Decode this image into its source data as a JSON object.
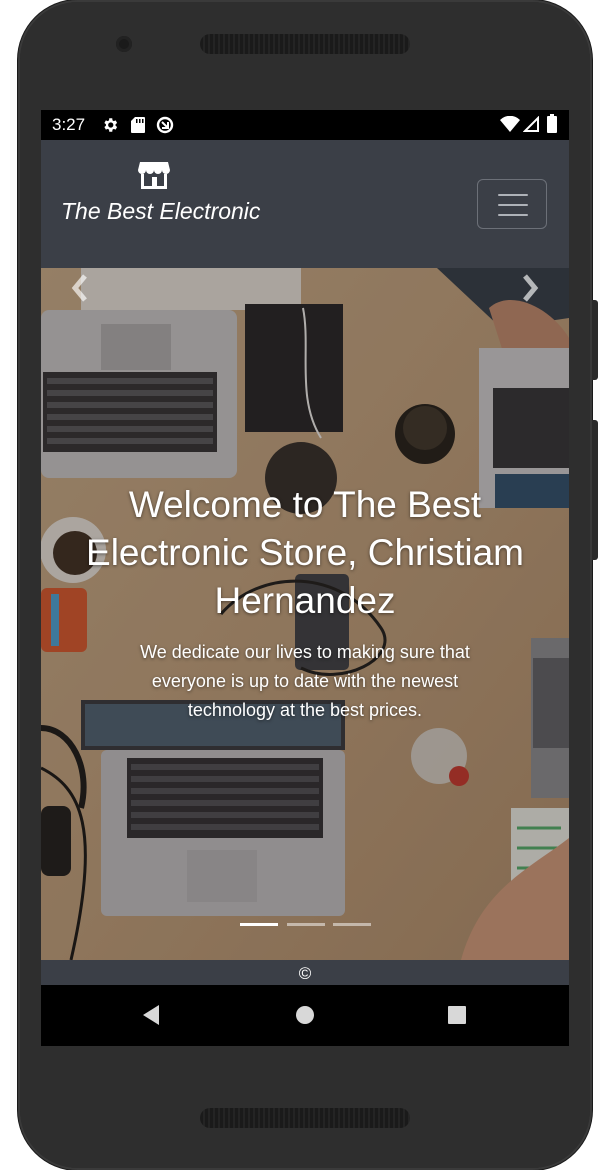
{
  "status_bar": {
    "time": "3:27",
    "icons": [
      "settings-icon",
      "sd-card-icon",
      "sync-icon",
      "wifi-icon",
      "signal-icon",
      "battery-icon"
    ]
  },
  "navbar": {
    "brand_icon": "store-icon",
    "brand_text": "The Best Electronic",
    "menu_icon": "hamburger-menu-icon"
  },
  "hero": {
    "title": "Welcome to The Best Electronic Store, Christiam Hernandez",
    "subtitle": "We dedicate our lives to making sure that everyone is up to date with the newest technology at the best prices.",
    "prev_icon": "chevron-left-icon",
    "next_icon": "chevron-right-icon",
    "slides": 3,
    "active_slide": 1
  },
  "footer": {
    "text": "©"
  },
  "system_nav": {
    "buttons": [
      "back-icon",
      "home-icon",
      "recents-icon"
    ]
  },
  "colors": {
    "navbar_bg": "#3b3f47",
    "text": "#ffffff"
  }
}
